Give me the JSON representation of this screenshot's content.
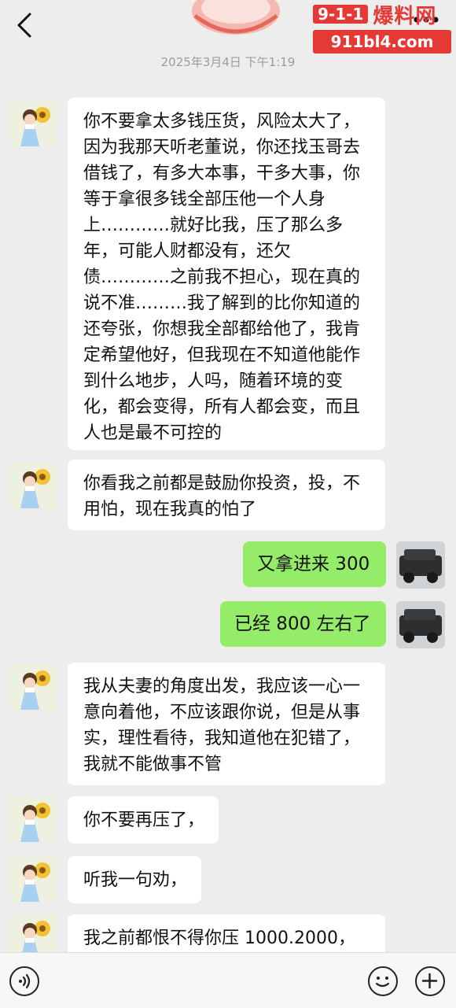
{
  "header": {
    "back_icon": "chevron-left-icon",
    "more_label": "...",
    "watermark_brand_box": "9-1-1",
    "watermark_brand_cn": "爆料网",
    "watermark_url": "911bl4.com"
  },
  "timestamp": "2025年3月4日 下午1:19",
  "messages": [
    {
      "side": "left",
      "text": "你不要拿太多钱压货，风险太大了，因为我那天听老董说，你还找玉哥去借钱了，有多大本事，干多大事，你等于拿很多钱全部压他一个人身上…………就好比我，压了那么多年，可能人财都没有，还欠债…………之前我不担心，现在真的说不准………我了解到的比你知道的还夸张，你想我全部都给他了，我肯定希望他好，但我现在不知道他能作到什么地步，人吗，随着环境的变化，都会变得，所有人都会变，而且人也是最不可控的"
    },
    {
      "side": "left",
      "text": "你看我之前都是鼓励你投资，投，不用怕，现在我真的怕了"
    },
    {
      "side": "right",
      "text": "又拿进来 300"
    },
    {
      "side": "right",
      "text": "已经 800 左右了"
    },
    {
      "side": "left",
      "text": "我从夫妻的角度出发，我应该一心一意向着他，不应该跟你说，但是从事实，理性看待，我知道他在犯错了，我就不能做事不管"
    },
    {
      "side": "left",
      "text": "你不要再压了，"
    },
    {
      "side": "left",
      "text": "听我一句劝，"
    },
    {
      "side": "left",
      "text": "我之前都恨不得你压 1000.2000，"
    }
  ],
  "bottom_bar": {
    "voice_icon": "voice-icon",
    "emoji_icon": "emoji-icon",
    "plus_icon": "plus-icon"
  },
  "colors": {
    "background": "#ededed",
    "incoming_bubble": "#ffffff",
    "outgoing_bubble": "#95ec69",
    "timestamp": "#9c9c9c",
    "watermark": "#e53935"
  }
}
